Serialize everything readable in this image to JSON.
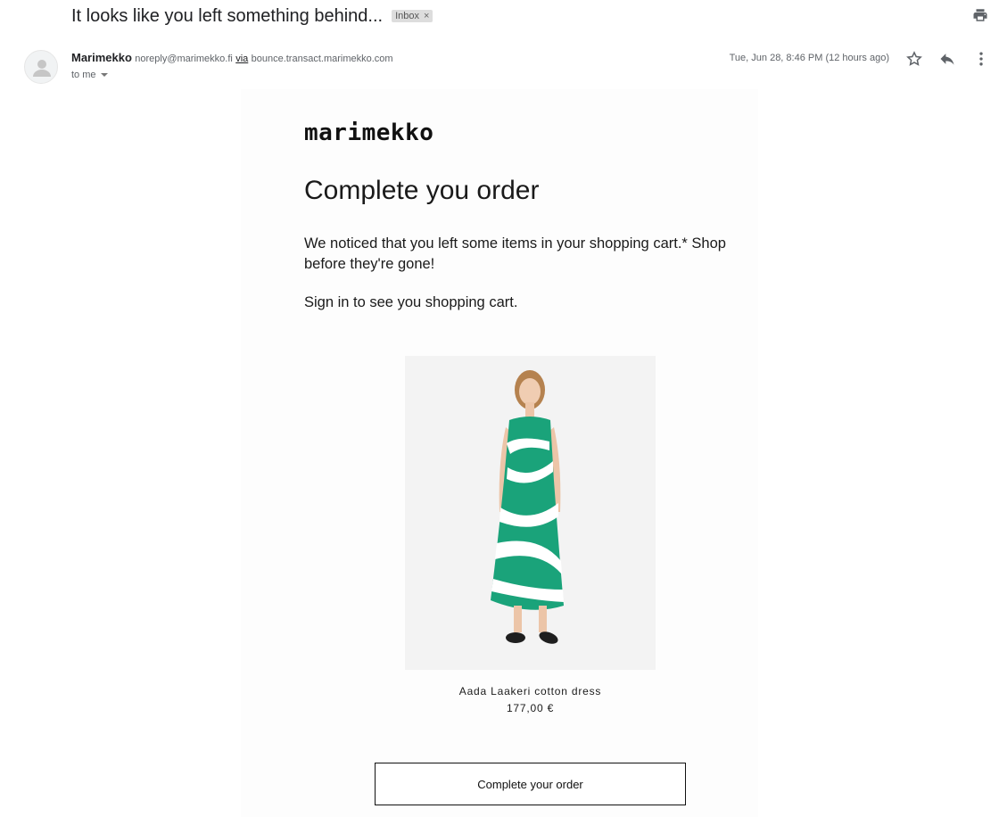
{
  "email": {
    "subject": "It looks like you left something behind...",
    "label": "Inbox",
    "label_close": "×",
    "sender_name": "Marimekko",
    "sender_email": "noreply@marimekko.fi",
    "via": "via",
    "via_domain": "bounce.transact.marimekko.com",
    "recipient": "to me",
    "date": "Tue, Jun 28, 8:46 PM (12 hours ago)"
  },
  "icons": {
    "print": "print-icon",
    "star": "star-icon",
    "reply": "reply-icon",
    "more": "more-vertical-icon",
    "avatar": "person-icon"
  },
  "body": {
    "logo": "marimekko",
    "headline": "Complete you order",
    "paragraph1": "We noticed that you left some items in your shopping cart.* Shop before they're gone!",
    "paragraph2": "Sign in to see you shopping cart.",
    "product": {
      "name": "Aada Laakeri cotton dress",
      "price": "177,00 €"
    },
    "cta_label": "Complete your order"
  },
  "colors": {
    "dress_green": "#1aa37a",
    "text": "#202124"
  }
}
